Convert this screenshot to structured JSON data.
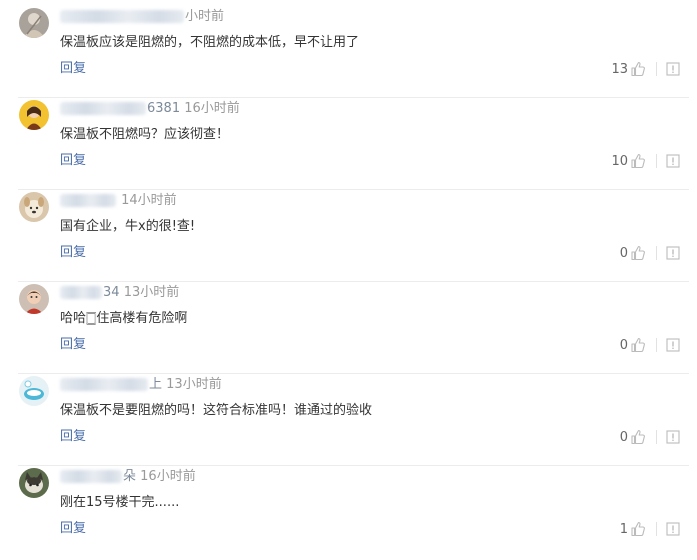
{
  "comments": [
    {
      "name_suffix": "",
      "time": "小时前",
      "text": "保温板应该是阻燃的，不阻燃的成本低，早不让用了",
      "reply": "回复",
      "likes": "13",
      "avatar": "avatar-default"
    },
    {
      "name_suffix": "6381",
      "time": "16小时前",
      "text": "保温板不阻燃吗？应该彻查！",
      "reply": "回复",
      "likes": "10",
      "avatar": "avatar-girl"
    },
    {
      "name_suffix": "",
      "time": "14小时前",
      "text": "国有企业，牛x的很!查!",
      "reply": "回复",
      "likes": "0",
      "avatar": "avatar-dog"
    },
    {
      "name_suffix": "34",
      "time": "13小时前",
      "text": "哈哈🀆住高楼有危险啊",
      "reply": "回复",
      "likes": "0",
      "avatar": "avatar-kid"
    },
    {
      "name_suffix": "上",
      "time": "13小时前",
      "text": "保温板不是要阻燃的吗！这符合标准吗！谁通过的验收",
      "reply": "回复",
      "likes": "0",
      "avatar": "avatar-bird"
    },
    {
      "name_suffix": "朵",
      "time": "16小时前",
      "text": "刚在15号楼干完......",
      "reply": "回复",
      "likes": "1",
      "avatar": "avatar-cat"
    }
  ],
  "colors": {
    "reply_link": "#4a6ea9",
    "meta_gray": "#999999",
    "body_text": "#333333",
    "icon_gray": "#bbbbbb"
  }
}
